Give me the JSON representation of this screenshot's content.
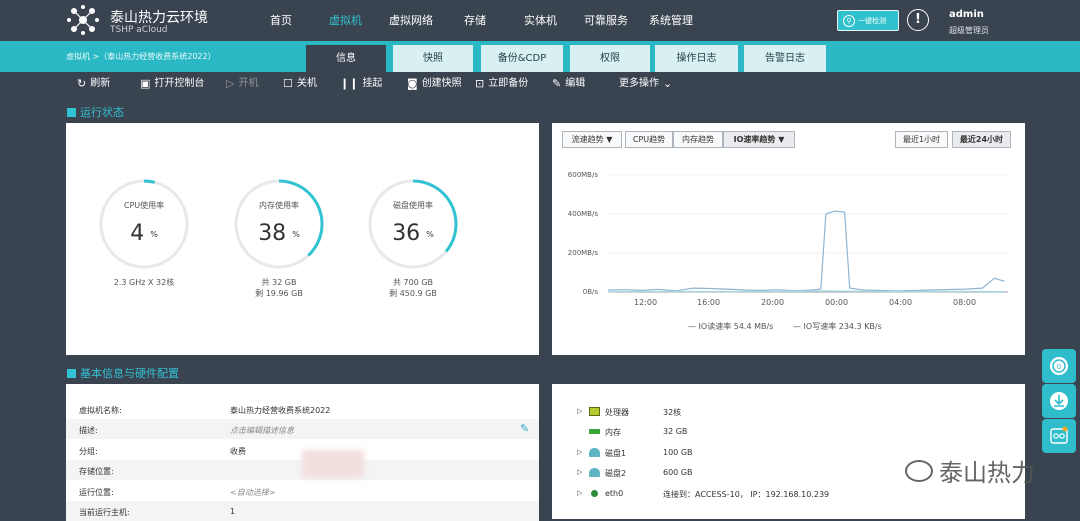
{
  "header": {
    "brand_title": "泰山热力云环境",
    "brand_subtitle": "TSHP aCloud",
    "nav": [
      "首页",
      "虚拟机",
      "虚拟网络",
      "存储",
      "实体机",
      "可靠服务",
      "系统管理"
    ],
    "active_nav": "虚拟机",
    "detect_button": "一键检测",
    "user": "admin",
    "role": "超级管理员"
  },
  "tabbar": {
    "breadcrumb": "虚拟机 >（泰山热力经营收费系统2022）",
    "tabs": [
      "信息",
      "快照",
      "备份&CDP",
      "权限",
      "操作日志",
      "告警日志"
    ],
    "active_tab": "信息"
  },
  "toolbar": {
    "refresh": "刷新",
    "console": "打开控制台",
    "power_on": "开机",
    "shutdown": "关机",
    "suspend": "挂起",
    "snapshot": "创建快照",
    "backup": "立即备份",
    "edit": "编辑",
    "more": "更多操作"
  },
  "run_status": {
    "title": "运行状态",
    "cpu": {
      "label": "CPU使用率",
      "value": "4",
      "unit": "%",
      "sub1": "2.3 GHz X 32核",
      "fraction": 0.04
    },
    "memory": {
      "label": "内存使用率",
      "value": "38",
      "unit": "%",
      "sub1": "共 32 GB",
      "sub2": "剩 19.96 GB",
      "fraction": 0.38
    },
    "disk": {
      "label": "磁盘使用率",
      "value": "36",
      "unit": "%",
      "sub1": "共 700 GB",
      "sub2": "剩 450.9 GB",
      "fraction": 0.36
    }
  },
  "trend": {
    "tabs": [
      "流速趋势",
      "CPU趋势",
      "内存趋势",
      "IO速率趋势"
    ],
    "range_buttons": [
      "最近1小时",
      "最近24小时"
    ],
    "legend_read": "IO读速率 54.4 MB/s",
    "legend_write": "IO写速率 234.3 KB/s"
  },
  "chart_data": {
    "type": "line",
    "x": [
      "12:00",
      "16:00",
      "20:00",
      "00:00",
      "04:00",
      "08:00"
    ],
    "y_ticks": [
      "600MB/s",
      "400MB/s",
      "200MB/s",
      "0B/s"
    ],
    "ylim": [
      0,
      600
    ],
    "series": [
      {
        "name": "IO读速率",
        "color": "#8fb5d4",
        "points": [
          [
            10.5,
            10
          ],
          [
            11.5,
            12
          ],
          [
            12.5,
            8
          ],
          [
            13.5,
            14
          ],
          [
            14.5,
            6
          ],
          [
            15.5,
            20
          ],
          [
            16.5,
            18
          ],
          [
            17.5,
            15
          ],
          [
            18.5,
            10
          ],
          [
            19.5,
            8
          ],
          [
            20.5,
            12
          ],
          [
            21.5,
            6
          ],
          [
            22.5,
            10
          ],
          [
            23.0,
            15
          ],
          [
            23.3,
            400
          ],
          [
            23.8,
            415
          ],
          [
            24.4,
            410
          ],
          [
            24.7,
            20
          ],
          [
            25.5,
            10
          ],
          [
            27.5,
            5
          ],
          [
            29.5,
            10
          ],
          [
            31.5,
            15
          ],
          [
            32.5,
            20
          ],
          [
            33.2,
            70
          ],
          [
            33.8,
            55
          ]
        ]
      },
      {
        "name": "IO写速率",
        "color": "#a8d8dd",
        "points": [
          [
            10.5,
            2
          ],
          [
            14,
            3
          ],
          [
            18,
            2
          ],
          [
            22,
            3
          ],
          [
            23.3,
            5
          ],
          [
            24.5,
            4
          ],
          [
            28,
            2
          ],
          [
            32,
            3
          ],
          [
            33.8,
            2
          ]
        ]
      }
    ]
  },
  "basic_info": {
    "title": "基本信息与硬件配置",
    "rows": [
      {
        "k": "虚拟机名称:",
        "v": "泰山热力经营收费系统2022"
      },
      {
        "k": "描述:",
        "v": "点击编辑描述信息"
      },
      {
        "k": "分组:",
        "v": "收费"
      },
      {
        "k": "存储位置:",
        "v": ""
      },
      {
        "k": "运行位置:",
        "v": "<自动选择>"
      },
      {
        "k": "当前运行主机:",
        "v": "1"
      }
    ]
  },
  "hardware": [
    {
      "name": "处理器",
      "value": "32核",
      "icon": "cpu-icon",
      "expand": true
    },
    {
      "name": "内存",
      "value": "32 GB",
      "icon": "memory-icon",
      "expand": false
    },
    {
      "name": "磁盘1",
      "value": "100 GB",
      "icon": "disk-icon",
      "expand": true
    },
    {
      "name": "磁盘2",
      "value": "600 GB",
      "icon": "disk-icon",
      "expand": true
    },
    {
      "name": "eth0",
      "value": "连接到：ACCESS-10， IP：192.168.10.239",
      "icon": "network-icon",
      "expand": true
    }
  ],
  "watermark": "泰山热力",
  "colors": {
    "accent": "#2ab8c4",
    "dark": "#3a4350"
  }
}
